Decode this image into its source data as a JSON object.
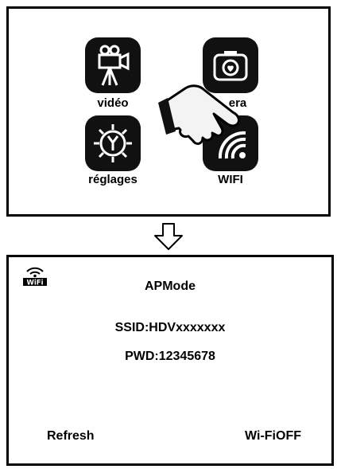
{
  "menu": {
    "items": [
      {
        "label": "vidéo",
        "icon": "video-camera-icon"
      },
      {
        "label": "era",
        "icon": "camera-icon"
      },
      {
        "label": "réglages",
        "icon": "settings-gear-icon"
      },
      {
        "label": "WIFI",
        "icon": "wifi-icon"
      }
    ]
  },
  "transition": {
    "icon": "down-arrow-icon"
  },
  "wifi_screen": {
    "status_badge": "WiFi",
    "title": "APMode",
    "ssid": "SSID:HDVxxxxxxx",
    "password": "PWD:12345678",
    "refresh_label": "Refresh",
    "wifi_off_label": "Wi-FiOFF"
  }
}
